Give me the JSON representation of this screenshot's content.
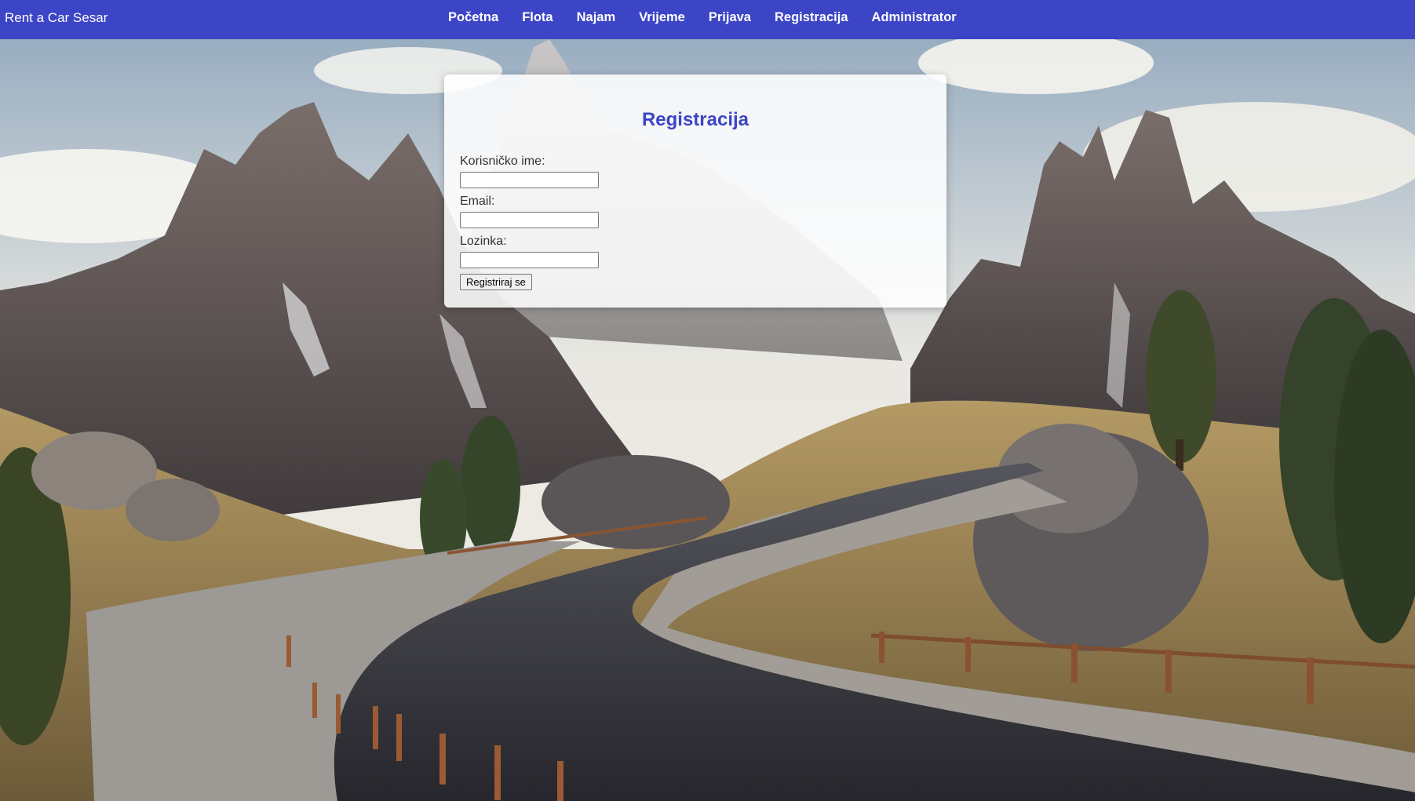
{
  "nav": {
    "brand": "Rent a Car Sesar",
    "links": [
      "Početna",
      "Flota",
      "Najam",
      "Vrijeme",
      "Prijava",
      "Registracija",
      "Administrator"
    ]
  },
  "form": {
    "title": "Registracija",
    "username_label": "Korisničko ime:",
    "username_value": "",
    "email_label": "Email:",
    "email_value": "",
    "password_label": "Lozinka:",
    "password_value": "",
    "submit_label": "Registriraj se"
  },
  "colors": {
    "accent": "#3c45c6",
    "card_background": "#ffffff",
    "label_text": "#333333"
  }
}
